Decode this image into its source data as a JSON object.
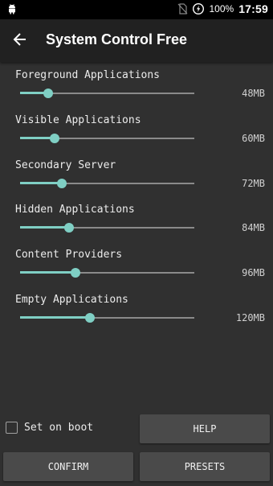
{
  "status_bar": {
    "battery_percent": "100%",
    "time": "17:59",
    "icons": [
      "android-icon",
      "no-sim-icon",
      "battery-saver-icon"
    ]
  },
  "app_bar": {
    "title": "System Control Free",
    "back_icon": "arrow-left-icon"
  },
  "settings": [
    {
      "label": "Foreground Applications",
      "value": "48MB",
      "level": 0.16
    },
    {
      "label": "Visible Applications",
      "value": "60MB",
      "level": 0.2
    },
    {
      "label": "Secondary Server",
      "value": "72MB",
      "level": 0.24
    },
    {
      "label": "Hidden Applications",
      "value": "84MB",
      "level": 0.28
    },
    {
      "label": "Content Providers",
      "value": "96MB",
      "level": 0.32
    },
    {
      "label": "Empty Applications",
      "value": "120MB",
      "level": 0.4
    }
  ],
  "set_on_boot": {
    "label": "Set on boot",
    "checked": false
  },
  "buttons": {
    "help": "HELP",
    "confirm": "CONFIRM",
    "presets": "PRESETS"
  },
  "colors": {
    "accent": "#7fcfc4",
    "background": "#303030",
    "app_bar": "#212121",
    "button": "#4a4a4a"
  }
}
